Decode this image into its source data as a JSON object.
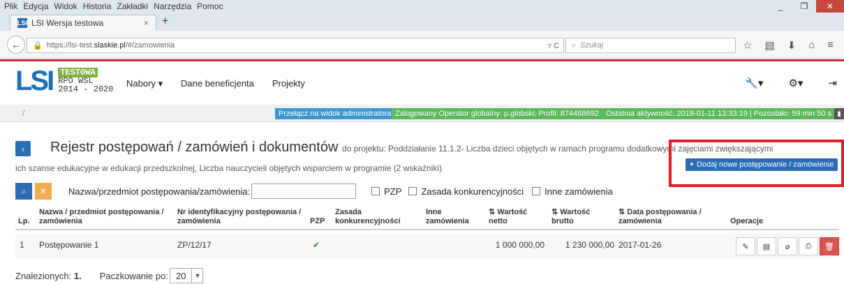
{
  "browser": {
    "menu": [
      "Plik",
      "Edycja",
      "Widok",
      "Historia",
      "Zakładki",
      "Narzędzia",
      "Pomoc"
    ],
    "tab_title": "LSI Wersja testowa",
    "url_prefix": "https://lsi-test.",
    "url_domain": "slaskie.pl",
    "url_suffix": "/#/zamowienia",
    "search_placeholder": "Szukaj"
  },
  "app": {
    "logo_text": "LSI",
    "logo_badge": "TESTOWA",
    "logo_line2": "RPO WSL",
    "logo_line3": "2014 - 2020",
    "nav": [
      "Nabory ▾",
      "Dane beneficjenta",
      "Projekty"
    ]
  },
  "infobar": {
    "switch_label": "Przełącz na widok administratora",
    "operator_label": "Zalogowany Operator globalny: p.globski; Profil: 874468692",
    "activity_label": "Ostatnia aktywność: 2018-01-11 13:33:19 | Pozostało: 59 min 50 s"
  },
  "page": {
    "title": "Rejestr postępowań / zamówień i dokumentów",
    "title_suffix": "do projektu: Poddziałanie 11.1.2- Liczba dzieci objętych w ramach programu dodatkowymi zajęciami zwiększającymi",
    "title_line2": "ich szanse edukacyjne w edukacji przedszkolnej, Liczba nauczycieli objętych wsparciem w programie (2 wskaźniki)",
    "add_button": "Dodaj nowe postępowanie / zamówienie"
  },
  "filters": {
    "name_label": "Nazwa/przedmiot postępowania/zamówienia:",
    "pzp": "PZP",
    "zasada": "Zasada konkurencyjności",
    "inne": "Inne zamówienia"
  },
  "table": {
    "headers": {
      "lp": "Lp.",
      "nazwa": "Nazwa / przedmiot postępowania / zamówienia",
      "nr": "Nr identyfikacyjny postępowania / zamówienia",
      "pzp": "PZP",
      "zasada": "Zasada konkurencyjności",
      "inne": "Inne zamówienia",
      "netto": "⇅ Wartość netto",
      "brutto": "⇅ Wartość brutto",
      "data": "⇅ Data postępowania / zamówienia",
      "operacje": "Operacje"
    },
    "rows": [
      {
        "lp": "1",
        "nazwa": "Postępowanie 1",
        "nr": "ZP/12/17",
        "pzp": "✔",
        "netto": "1 000 000,00",
        "brutto": "1 230 000,00",
        "data": "2017-01-26"
      }
    ]
  },
  "footer": {
    "found_label": "Znalezionych:",
    "found_count": "1.",
    "page_label": "Paczkowanie po:",
    "page_size": "20"
  }
}
